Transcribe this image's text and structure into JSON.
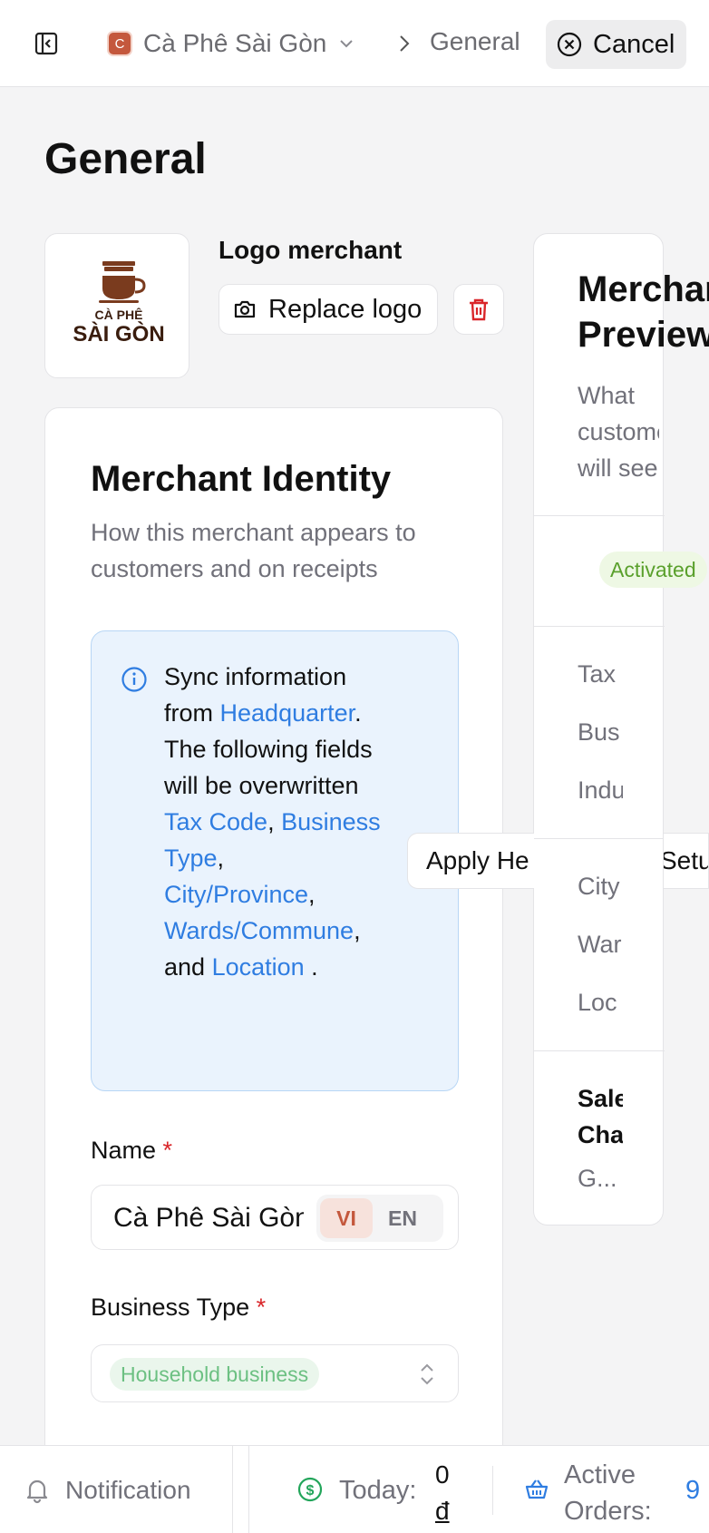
{
  "topbar": {
    "merchant_initial": "C",
    "merchant_name": "Cà Phê Sài Gòn",
    "current_page": "General",
    "cancel_label": "Cancel"
  },
  "page": {
    "title": "General"
  },
  "logo": {
    "heading": "Logo merchant",
    "replace_label": "Replace logo",
    "brand_line1": "CÀ PHÊ",
    "brand_line2": "SÀI GÒN"
  },
  "identity": {
    "title": "Merchant Identity",
    "subtitle": "How this merchant appears to customers and on receipts",
    "info": {
      "t1": "Sync information from ",
      "hq": "Headquarter",
      "t2": ". The following fields will be overwritten ",
      "f1": "Tax Code",
      "sep1": ", ",
      "f2": "Business Type",
      "sep2": ", ",
      "f3": "City/Province",
      "sep3": ", ",
      "f4": "Wards/Commune",
      "sep4": ", and ",
      "f5": "Location",
      "end": " ."
    },
    "name_label": "Name",
    "required_mark": "*",
    "name_value": "Cà Phê Sài Gòn",
    "lang_vi": "VI",
    "lang_en": "EN",
    "business_type_label": "Business Type",
    "business_type_value": "Household business"
  },
  "apply": {
    "part1": "Apply He",
    "part2": "Setu"
  },
  "preview": {
    "title_line1": "Merchant",
    "title_line2": "Preview",
    "subtitle": "What customers will see",
    "status": "Activated",
    "row_tax": "Tax",
    "row_bus": "Bus",
    "row_ind": "Indu",
    "row_city": "City",
    "row_ward": "War",
    "row_loc": "Loc",
    "sales_1": "Sale",
    "sales_2": "Cha",
    "sales_3": "G..."
  },
  "bottombar": {
    "notification_label": "Notification",
    "today_label": "Today:",
    "today_amount": "0",
    "today_currency": "đ",
    "orders_label": "Active Orders:",
    "orders_value": "9"
  },
  "colors": {
    "accent": "#2f7de1",
    "brand": "#c4583d",
    "danger": "#d9262a",
    "success": "#5aa02c",
    "logo_brown": "#7a3b1e"
  }
}
